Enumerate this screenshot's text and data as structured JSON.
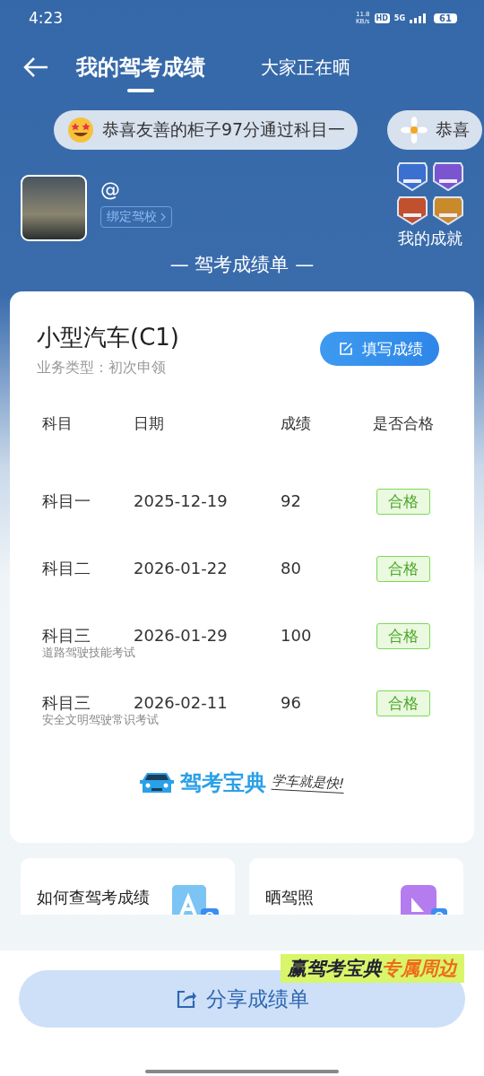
{
  "status_bar": {
    "time": "4:23",
    "net_speed": "11.8",
    "net_unit": "KB/s",
    "hd": "HD",
    "network": "5G",
    "battery": "61"
  },
  "tabs": [
    {
      "label": "我的驾考成绩",
      "selected": true
    },
    {
      "label": "大家正在晒",
      "selected": false
    }
  ],
  "ticker": [
    {
      "kind": "star-face",
      "text": "恭喜友善的柜子97分通过科目一"
    },
    {
      "kind": "flower",
      "text": "恭喜"
    }
  ],
  "profile": {
    "handle": "@",
    "bind_school": "绑定驾校",
    "achievements_label": "我的成就"
  },
  "section_title": "— 驾考成绩单 —",
  "card": {
    "vehicle": "小型汽车(C1)",
    "business_type": "业务类型：初次申领",
    "fill_button": "填写成绩",
    "columns": [
      "科目",
      "日期",
      "成绩",
      "是否合格"
    ],
    "rows": [
      {
        "subject": "科目一",
        "date": "2025-12-19",
        "score": "92",
        "result": "合格",
        "passed": true
      },
      {
        "subject": "科目二",
        "date": "2026-01-22",
        "score": "80",
        "result": "合格",
        "passed": true
      },
      {
        "subject": "科目三",
        "note": "道路驾驶技能考试",
        "date": "2026-01-29",
        "score": "100",
        "result": "合格",
        "passed": true
      },
      {
        "subject": "科目三",
        "note": "安全文明驾驶常识考试",
        "date": "2026-02-11",
        "score": "96",
        "result": "合格",
        "passed": true
      }
    ],
    "brand": {
      "name": "驾考宝典",
      "slogan": "学车就是快!"
    }
  },
  "links": [
    {
      "kind": "search",
      "label": "如何查驾考成绩"
    },
    {
      "kind": "photo",
      "label": "晒驾照"
    }
  ],
  "banner": {
    "text": "赢驾考宝典",
    "highlight": "专属周边"
  },
  "share_button": "分享成绩单"
}
